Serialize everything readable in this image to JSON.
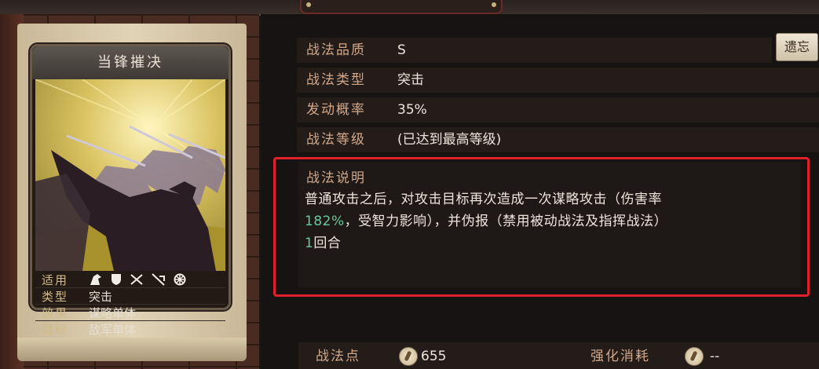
{
  "card": {
    "title": "当锋摧决",
    "stats": [
      {
        "label": "适用",
        "icons": [
          "cavalry-icon",
          "shield-icon",
          "crossed-spears-icon",
          "bow-icon",
          "wheel-icon"
        ]
      },
      {
        "label": "类型",
        "value": "突击"
      },
      {
        "label": "效果",
        "value": "谋略单体"
      },
      {
        "label": "目标",
        "value": "敌军单体"
      }
    ]
  },
  "details": {
    "quality_label": "战法品质",
    "quality_value": "S",
    "type_label": "战法类型",
    "type_value": "突击",
    "rate_label": "发动概率",
    "rate_value": "35%",
    "level_label": "战法等级",
    "level_value": "(已达到最高等级)",
    "forget_button": "遗忘"
  },
  "description": {
    "title": "战法说明",
    "line1": "普通攻击之后，对攻击目标再次造成一次谋略攻击（伤害率",
    "line2_highlight": "182%",
    "line2_rest": "，受智力影响），并伪报（禁用被动战法及指挥战法）",
    "line3_num": "1",
    "line3_rest": "回合"
  },
  "footer": {
    "points_label": "战法点",
    "points_value": "655",
    "cost_label": "强化消耗",
    "cost_value": "--"
  },
  "colors": {
    "label": "#d2a88a",
    "value": "#ece6dc",
    "highlight": "#6bc79a",
    "frame": "#e0202a"
  }
}
